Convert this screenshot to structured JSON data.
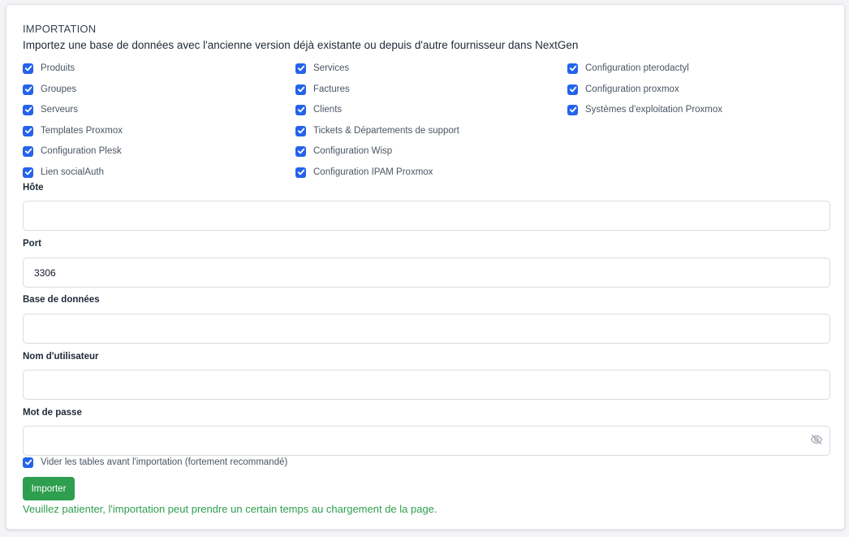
{
  "header": {
    "title": "IMPORTATION",
    "subtitle": "Importez une base de données avec l'ancienne version déjà existante ou depuis d'autre fournisseur dans NextGen"
  },
  "options": {
    "col1": [
      {
        "label": "Produits",
        "checked": true
      },
      {
        "label": "Groupes",
        "checked": true
      },
      {
        "label": "Serveurs",
        "checked": true
      },
      {
        "label": "Templates Proxmox",
        "checked": true
      },
      {
        "label": "Configuration Plesk",
        "checked": true
      },
      {
        "label": "Lien socialAuth",
        "checked": true
      }
    ],
    "col2": [
      {
        "label": "Services",
        "checked": true
      },
      {
        "label": "Factures",
        "checked": true
      },
      {
        "label": "Clients",
        "checked": true
      },
      {
        "label": "Tickets & Départements de support",
        "checked": true
      },
      {
        "label": "Configuration Wisp",
        "checked": true
      },
      {
        "label": "Configuration IPAM Proxmox",
        "checked": true
      }
    ],
    "col3": [
      {
        "label": "Configuration pterodactyl",
        "checked": true
      },
      {
        "label": "Configuration proxmox",
        "checked": true
      },
      {
        "label": "Systèmes d'exploitation Proxmox",
        "checked": true
      }
    ]
  },
  "form": {
    "host": {
      "label": "Hôte",
      "value": ""
    },
    "port": {
      "label": "Port",
      "value": "3306"
    },
    "database": {
      "label": "Base de données",
      "value": ""
    },
    "username": {
      "label": "Nom d'utilisateur",
      "value": ""
    },
    "password": {
      "label": "Mot de passe",
      "value": ""
    }
  },
  "truncate": {
    "label": "Vider les tables avant l'importation (fortement recommandé)",
    "checked": true
  },
  "submit": {
    "label": "Importer"
  },
  "notice": "Veuillez patienter, l'importation peut prendre un certain temps au chargement de la page.",
  "colors": {
    "accent": "#2563eb",
    "success": "#2e9e4f"
  }
}
